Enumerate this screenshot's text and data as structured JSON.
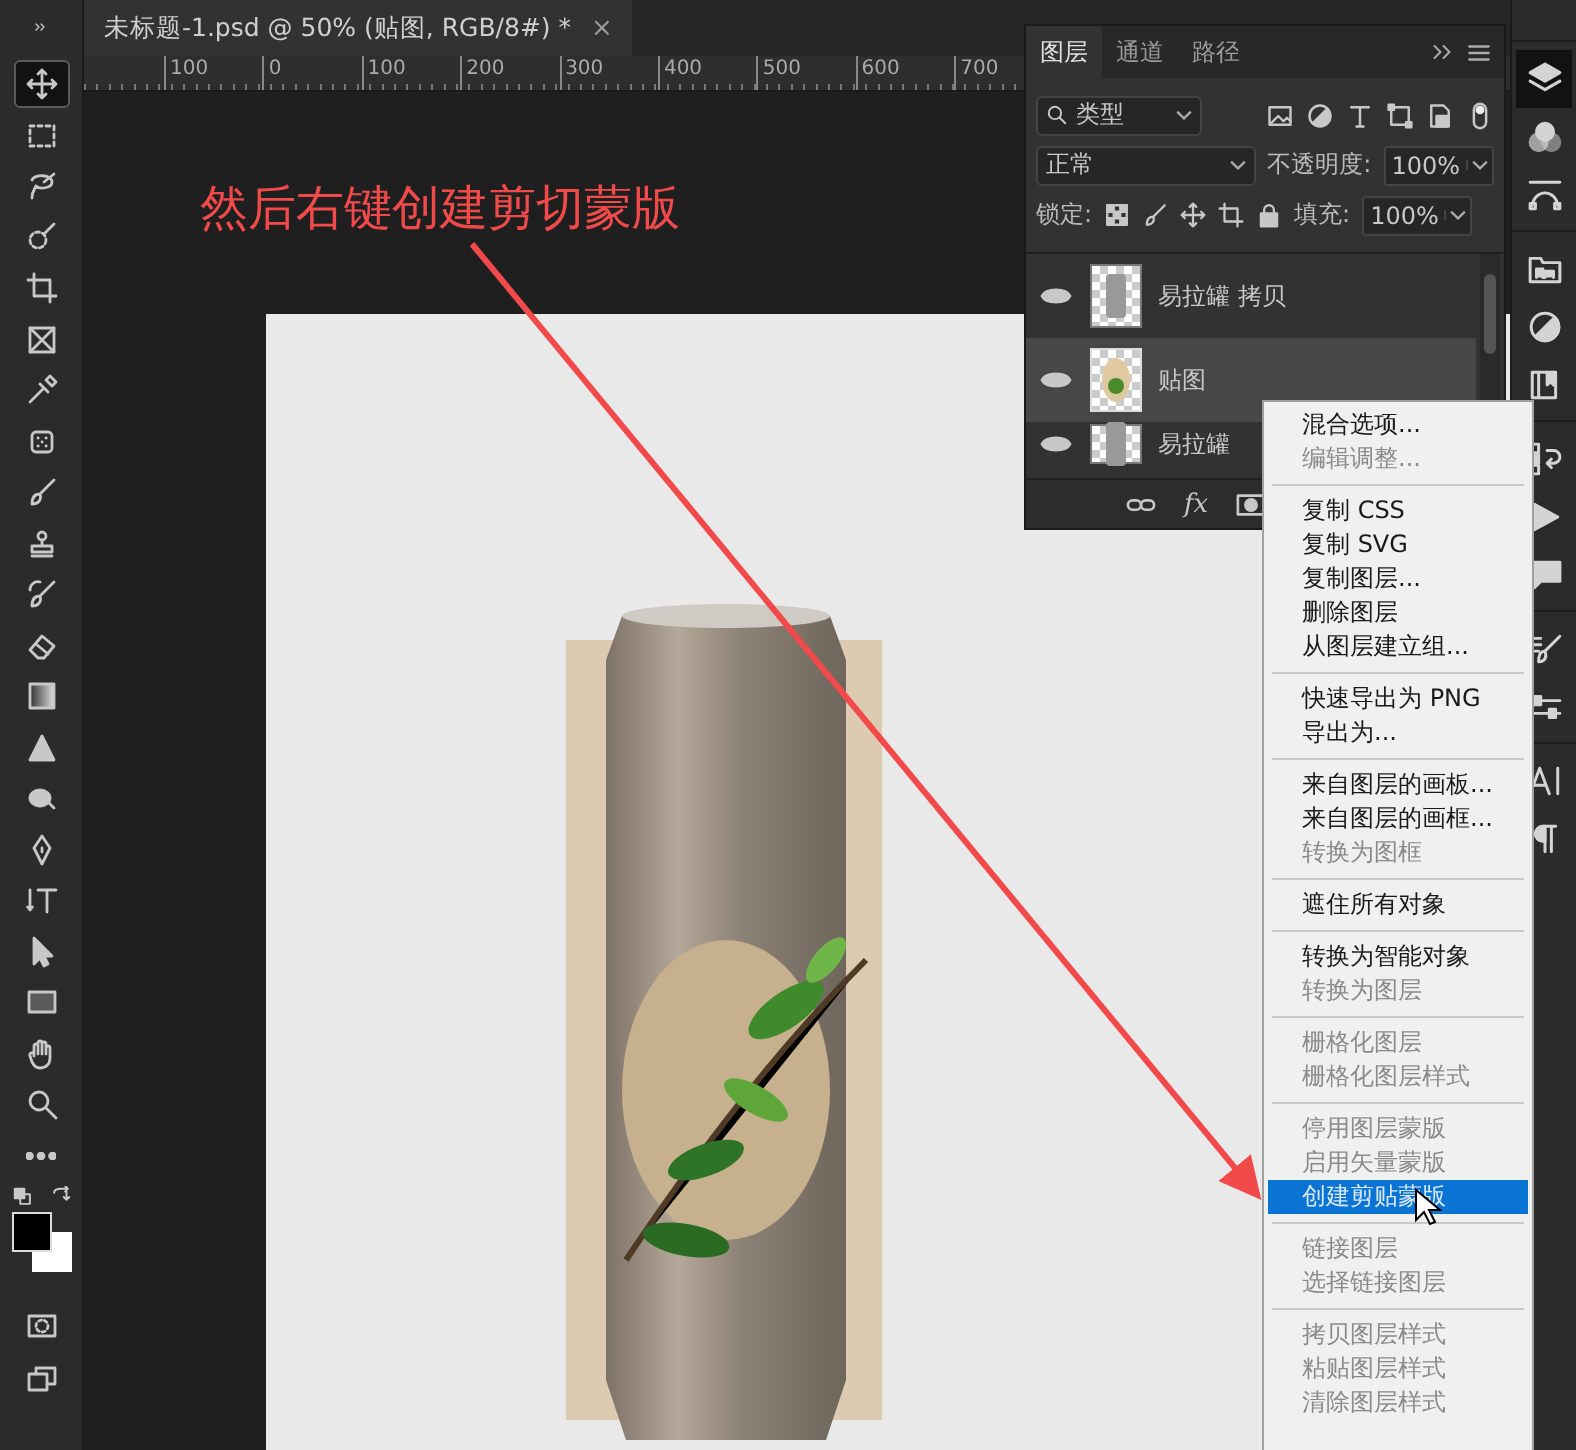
{
  "document_tab": {
    "title": "未标题-1.psd @ 50% (贴图, RGB/8#) *",
    "close": "×"
  },
  "ruler": {
    "labels": [
      "100",
      "0",
      "100",
      "200",
      "300",
      "400",
      "500",
      "600",
      "700"
    ]
  },
  "annotation": {
    "text": "然后右键创建剪切蒙版"
  },
  "toolbar": {
    "tools": [
      {
        "kind": "move",
        "selected": true
      },
      {
        "kind": "marquee",
        "selected": false
      },
      {
        "kind": "lasso",
        "selected": false
      },
      {
        "kind": "quickselect",
        "selected": false
      },
      {
        "kind": "crop",
        "selected": false
      },
      {
        "kind": "frame",
        "selected": false
      },
      {
        "kind": "eyedropper",
        "selected": false
      },
      {
        "kind": "heal",
        "selected": false
      },
      {
        "kind": "brush",
        "selected": false
      },
      {
        "kind": "stamp",
        "selected": false
      },
      {
        "kind": "historybrush",
        "selected": false
      },
      {
        "kind": "eraser",
        "selected": false
      },
      {
        "kind": "gradient",
        "selected": false
      },
      {
        "kind": "blur",
        "selected": false
      },
      {
        "kind": "dodge",
        "selected": false
      },
      {
        "kind": "pen",
        "selected": false
      },
      {
        "kind": "type",
        "selected": false
      },
      {
        "kind": "pathselect",
        "selected": false
      },
      {
        "kind": "rectangle",
        "selected": false
      },
      {
        "kind": "hand",
        "selected": false
      },
      {
        "kind": "zoom",
        "selected": false
      },
      {
        "kind": "more",
        "selected": false
      },
      {
        "kind": "colors",
        "selected": false
      },
      {
        "kind": "quickmask",
        "selected": false
      },
      {
        "kind": "screenmode",
        "selected": false
      }
    ]
  },
  "layers_panel": {
    "tabs": [
      {
        "label": "图层",
        "selected": true
      },
      {
        "label": "通道",
        "selected": false
      },
      {
        "label": "路径",
        "selected": false
      }
    ],
    "filter": "类型",
    "blend_mode": "正常",
    "opacity_label": "不透明度:",
    "opacity": "100%",
    "lock_label": "锁定:",
    "fill_label": "填充:",
    "fill": "100%",
    "layers": [
      {
        "name": "易拉罐 拷贝",
        "visible": true,
        "selected": false,
        "kind": "can"
      },
      {
        "name": "贴图",
        "visible": true,
        "selected": true,
        "kind": "label"
      },
      {
        "name": "易拉罐",
        "visible": true,
        "selected": false,
        "kind": "can"
      }
    ],
    "effects_button": "fx"
  },
  "context_menu": {
    "groups": [
      {
        "items": [
          {
            "label": "混合选项...",
            "disabled": false,
            "selected": false
          },
          {
            "label": "编辑调整...",
            "disabled": true,
            "selected": false
          }
        ]
      },
      {
        "items": [
          {
            "label": "复制 CSS",
            "disabled": false,
            "selected": false
          },
          {
            "label": "复制 SVG",
            "disabled": false,
            "selected": false
          },
          {
            "label": "复制图层...",
            "disabled": false,
            "selected": false
          },
          {
            "label": "删除图层",
            "disabled": false,
            "selected": false
          },
          {
            "label": "从图层建立组...",
            "disabled": false,
            "selected": false
          }
        ]
      },
      {
        "items": [
          {
            "label": "快速导出为 PNG",
            "disabled": false,
            "selected": false
          },
          {
            "label": "导出为...",
            "disabled": false,
            "selected": false
          }
        ]
      },
      {
        "items": [
          {
            "label": "来自图层的画板...",
            "disabled": false,
            "selected": false
          },
          {
            "label": "来自图层的画框...",
            "disabled": false,
            "selected": false
          },
          {
            "label": "转换为图框",
            "disabled": true,
            "selected": false
          }
        ]
      },
      {
        "items": [
          {
            "label": "遮住所有对象",
            "disabled": false,
            "selected": false
          }
        ]
      },
      {
        "items": [
          {
            "label": "转换为智能对象",
            "disabled": false,
            "selected": false
          },
          {
            "label": "转换为图层",
            "disabled": true,
            "selected": false
          }
        ]
      },
      {
        "items": [
          {
            "label": "栅格化图层",
            "disabled": true,
            "selected": false
          },
          {
            "label": "栅格化图层样式",
            "disabled": true,
            "selected": false
          }
        ]
      },
      {
        "items": [
          {
            "label": "停用图层蒙版",
            "disabled": true,
            "selected": false
          },
          {
            "label": "启用矢量蒙版",
            "disabled": true,
            "selected": false
          },
          {
            "label": "创建剪贴蒙版",
            "disabled": false,
            "selected": true
          }
        ]
      },
      {
        "items": [
          {
            "label": "链接图层",
            "disabled": true,
            "selected": false
          },
          {
            "label": "选择链接图层",
            "disabled": true,
            "selected": false
          }
        ]
      },
      {
        "items": [
          {
            "label": "拷贝图层样式",
            "disabled": true,
            "selected": false
          },
          {
            "label": "粘贴图层样式",
            "disabled": true,
            "selected": false
          },
          {
            "label": "清除图层样式",
            "disabled": true,
            "selected": false
          }
        ]
      }
    ]
  },
  "dock": {
    "groups": [
      {
        "items": [
          {
            "kind": "layers",
            "selected": true
          },
          {
            "kind": "channels",
            "selected": false
          },
          {
            "kind": "paths",
            "selected": false
          }
        ]
      },
      {
        "items": [
          {
            "kind": "libraries",
            "selected": false
          },
          {
            "kind": "adjustments",
            "selected": false
          },
          {
            "kind": "book",
            "selected": false
          }
        ]
      },
      {
        "items": [
          {
            "kind": "history",
            "selected": false
          },
          {
            "kind": "actions",
            "selected": false
          },
          {
            "kind": "comments",
            "selected": false
          }
        ]
      },
      {
        "items": [
          {
            "kind": "brushes",
            "selected": false
          },
          {
            "kind": "properties",
            "selected": false
          }
        ]
      },
      {
        "items": [
          {
            "kind": "character",
            "selected": false
          },
          {
            "kind": "paragraph",
            "selected": false
          }
        ]
      }
    ]
  }
}
